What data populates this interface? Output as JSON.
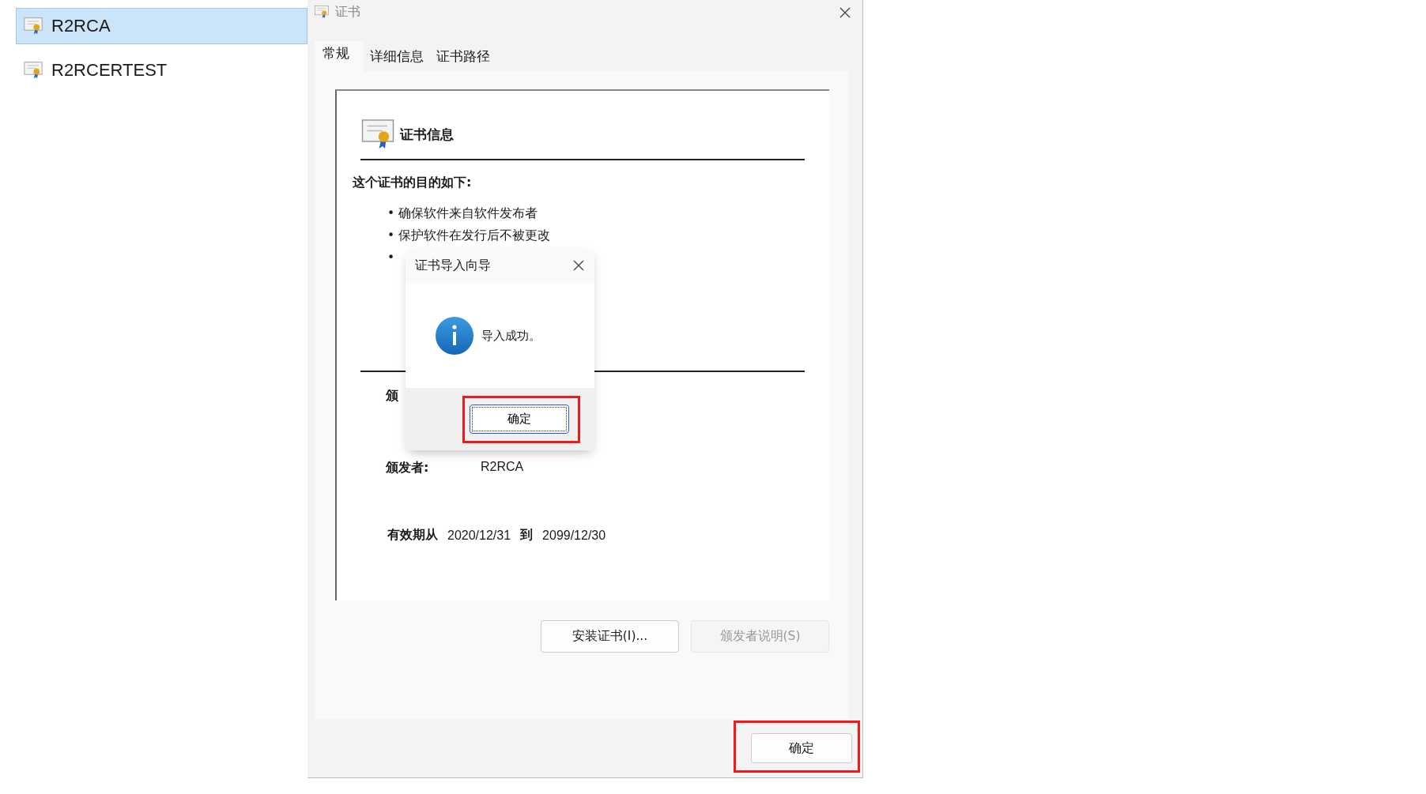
{
  "file_list": [
    {
      "name": "R2RCA",
      "selected": true
    },
    {
      "name": "R2RCERTEST",
      "selected": false
    }
  ],
  "window": {
    "title": "证书"
  },
  "tabs": [
    {
      "label": "常规",
      "selected": true
    },
    {
      "label": "详细信息",
      "selected": false
    },
    {
      "label": "证书路径",
      "selected": false
    }
  ],
  "cert_info": {
    "heading": "证书信息",
    "purpose_title": "这个证书的目的如下:",
    "purposes": [
      "• 确保软件来自软件发布者",
      "• 保护软件在发行后不被更改",
      "•"
    ],
    "issued_to_label": "颁",
    "issued_by_label": "颁发者:",
    "issued_by": "R2RCA",
    "valid_label": "有效期从",
    "valid_from": "2020/12/31",
    "valid_to_label": "到",
    "valid_to": "2099/12/30"
  },
  "buttons": [
    {
      "label": "安装证书(I)...",
      "disabled": false
    },
    {
      "label": "颁发者说明(S)",
      "disabled": true
    }
  ],
  "ok_button": {
    "label": "确定",
    "highlighted": true
  },
  "dialog": {
    "title": "证书导入向导",
    "message": "导入成功。",
    "button": {
      "label": "确定",
      "highlighted": true
    }
  }
}
